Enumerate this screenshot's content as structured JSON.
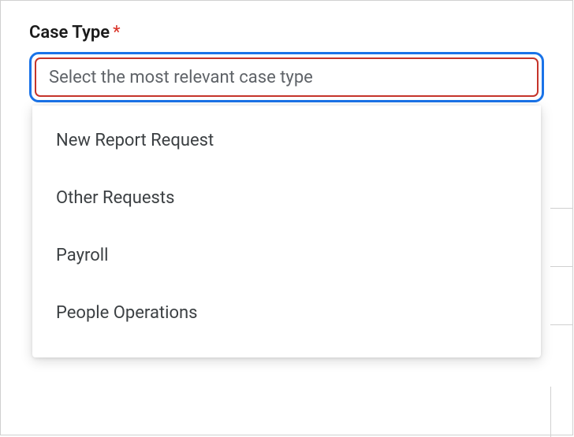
{
  "field": {
    "label": "Case Type",
    "required_marker": "*",
    "placeholder": "Select the most relevant case type"
  },
  "dropdown": {
    "options": [
      {
        "label": "New Report Request"
      },
      {
        "label": "Other Requests"
      },
      {
        "label": "Payroll"
      },
      {
        "label": "People Operations"
      }
    ]
  }
}
